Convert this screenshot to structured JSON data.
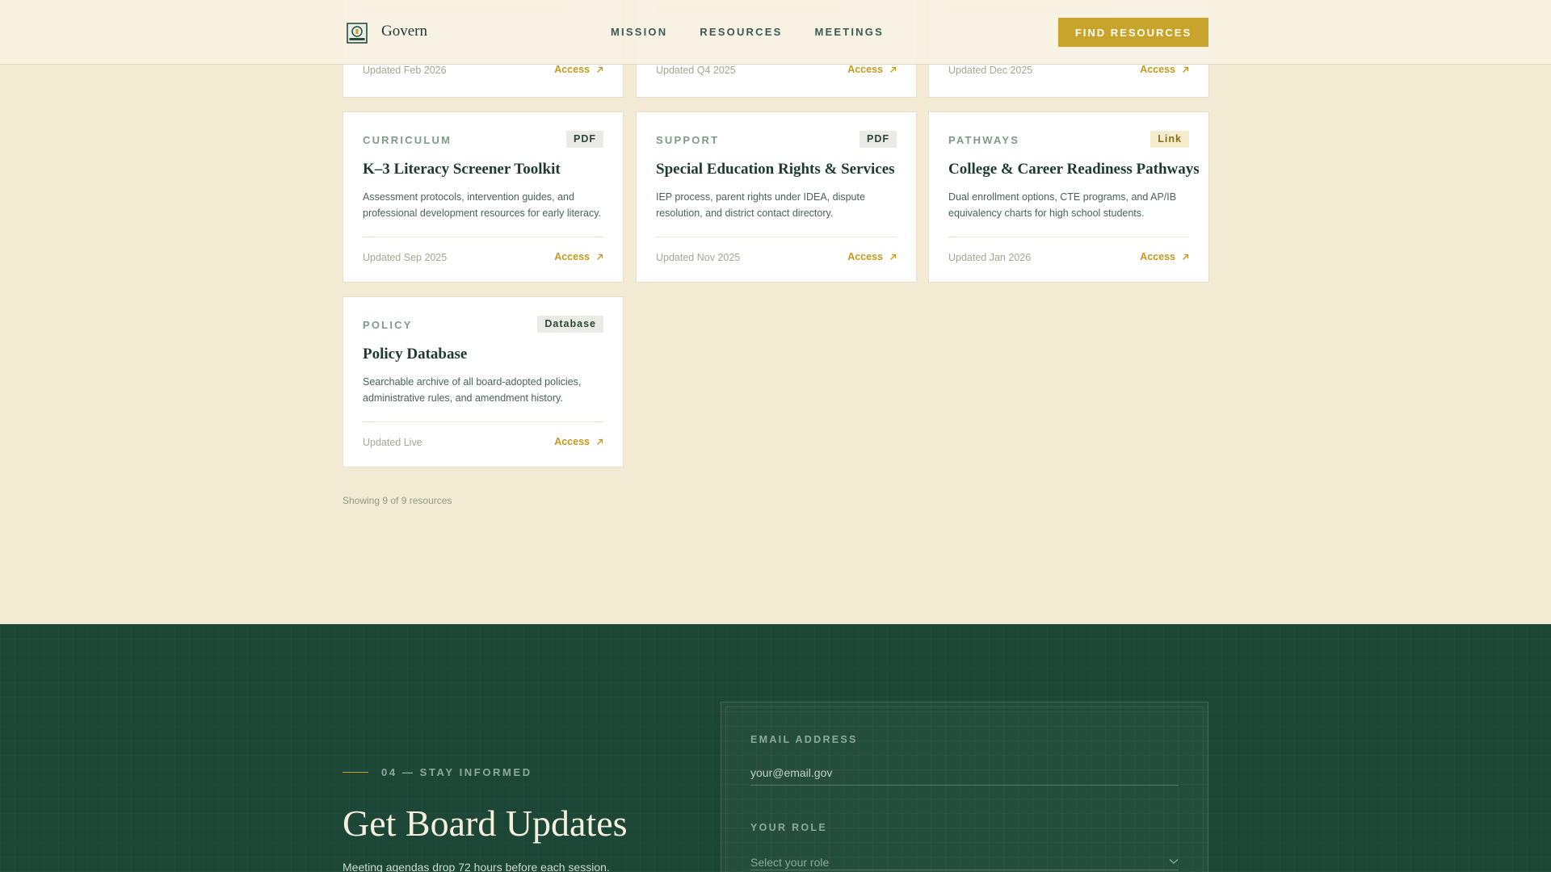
{
  "header": {
    "brand": "Govern",
    "nav": [
      "MISSION",
      "RESOURCES",
      "MEETINGS"
    ],
    "cta_label": "FIND RESOURCES"
  },
  "resources": {
    "partial_row": [
      {
        "updated": "Updated Feb 2026",
        "access": "Access"
      },
      {
        "updated": "Updated Q4 2025",
        "access": "Access"
      },
      {
        "updated": "Updated Dec 2025",
        "access": "Access"
      }
    ],
    "cards": [
      {
        "category": "CURRICULUM",
        "badge": "PDF",
        "title": "K–3 Literacy Screener Toolkit",
        "description": "Assessment protocols, intervention guides, and professional development resources for early literacy.",
        "updated": "Updated Sep 2025",
        "access": "Access"
      },
      {
        "category": "SUPPORT",
        "badge": "PDF",
        "title": "Special Education Rights & Services",
        "description": "IEP process, parent rights under IDEA, dispute resolution, and district contact directory.",
        "updated": "Updated Nov 2025",
        "access": "Access"
      },
      {
        "category": "PATHWAYS",
        "badge": "Link",
        "title": "College & Career Readiness Pathways",
        "description": "Dual enrollment options, CTE programs, and AP/IB equivalency charts for high school students.",
        "updated": "Updated Jan 2026",
        "access": "Access"
      },
      {
        "category": "POLICY",
        "badge": "Database",
        "title": "Policy Database",
        "description": "Searchable archive of all board-adopted policies, administrative rules, and amendment history.",
        "updated": "Updated Live",
        "access": "Access"
      }
    ],
    "count_text": "Showing 9 of 9 resources"
  },
  "newsletter": {
    "eyebrow": "04 — STAY INFORMED",
    "title": "Get Board Updates",
    "subtitle": "Meeting agendas drop 72 hours before each session.",
    "form": {
      "email_label": "EMAIL ADDRESS",
      "email_placeholder": "your@email.gov",
      "role_label": "YOUR ROLE",
      "role_placeholder": "Select your role"
    }
  },
  "colors": {
    "accent": "#c8a42c",
    "background": "#f3ead3",
    "footer": "#1c4636",
    "ink": "#1d3a2e"
  }
}
